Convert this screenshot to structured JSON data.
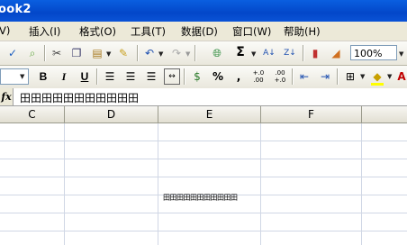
{
  "window": {
    "title": "ook2"
  },
  "menu": [
    {
      "label": "V)"
    },
    {
      "label": "插入(I)"
    },
    {
      "label": "格式(O)"
    },
    {
      "label": "工具(T)"
    },
    {
      "label": "数据(D)"
    },
    {
      "label": "窗口(W)"
    },
    {
      "label": "帮助(H)"
    }
  ],
  "toolbar": {
    "zoom": "100%",
    "sum": "Σ",
    "percent": "%",
    "comma": ",",
    "bold": "B",
    "italic": "I",
    "underline": "U",
    "inc_decimal": "+.0 .00",
    "dec_decimal": ".00 +.0"
  },
  "formula_bar": {
    "fx_label": "fx",
    "value": "田田田田田田田田田田田"
  },
  "columns": [
    "C",
    "D",
    "E",
    "F"
  ],
  "cells": {
    "e_row4": "田田田田田田田田田田田"
  },
  "colors": {
    "title_bar": "#0a53d6",
    "chrome": "#ece9d8",
    "grid": "#d0d7e5"
  }
}
